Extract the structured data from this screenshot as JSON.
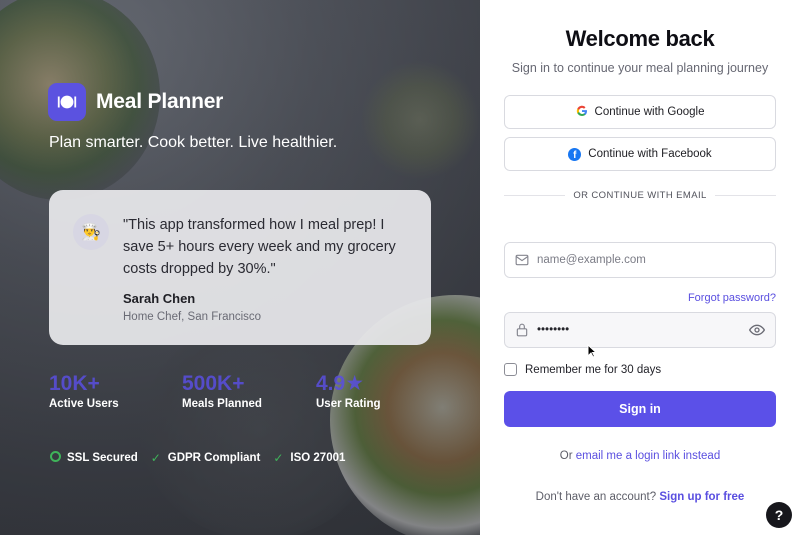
{
  "brand": {
    "name": "Meal Planner",
    "tagline": "Plan smarter. Cook better. Live healthier.",
    "accent": "#5B52E0"
  },
  "testimonial": {
    "avatar_icon": "chef-emoji",
    "avatar_glyph": "👨‍🍳",
    "quote": "\"This app transformed how I meal prep! I save 5+ hours every week and my grocery costs dropped by 30%.\"",
    "author": "Sarah Chen",
    "role": "Home Chef, San Francisco"
  },
  "stats": [
    {
      "value": "10K+",
      "label": "Active Users"
    },
    {
      "value": "500K+",
      "label": "Meals Planned"
    },
    {
      "value": "4.9",
      "label": "User Rating",
      "icon": "star-icon"
    }
  ],
  "badges": [
    {
      "label": "SSL Secured",
      "icon": "shield-icon"
    },
    {
      "label": "GDPR Compliant",
      "icon": "check-icon"
    },
    {
      "label": "ISO 27001",
      "icon": "check-icon"
    }
  ],
  "form": {
    "title": "Welcome back",
    "subtitle": "Sign in to continue your meal planning journey",
    "google_label": "Continue with Google",
    "facebook_label": "Continue with Facebook",
    "divider": "OR CONTINUE WITH EMAIL",
    "email_placeholder": "name@example.com",
    "email_value": "",
    "forgot": "Forgot password?",
    "password_value": "••••••••",
    "remember": "Remember me for 30 days",
    "remember_checked": false,
    "submit": "Sign in",
    "magic_prefix": "Or",
    "magic_link": "email me a login link instead",
    "signup_prefix": "Don't have an account?",
    "signup_link": "Sign up for free"
  },
  "help": {
    "label": "?"
  }
}
